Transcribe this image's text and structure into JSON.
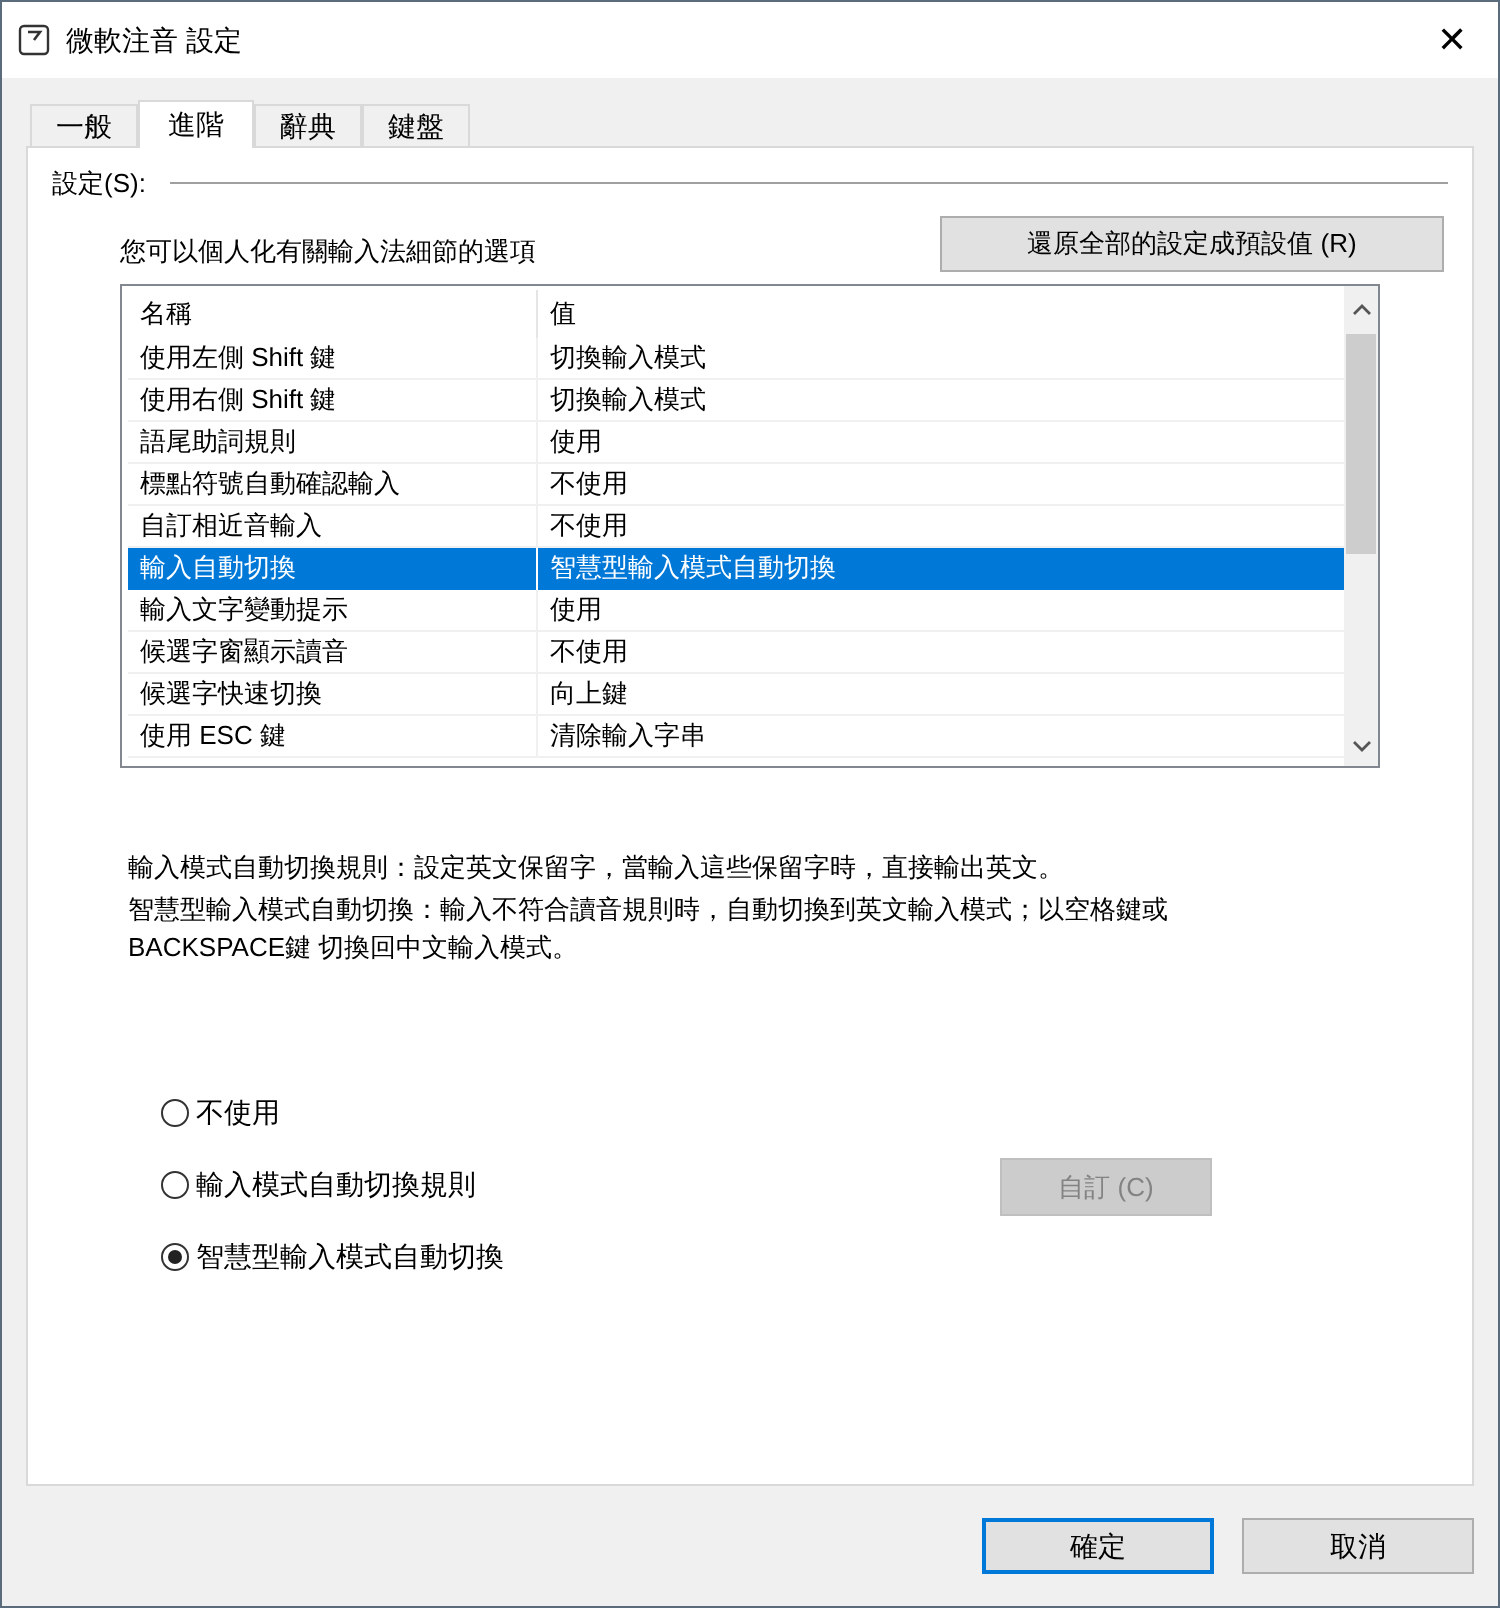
{
  "window": {
    "title": "微軟注音 設定",
    "close": "✕"
  },
  "tabs": [
    {
      "label": "一般",
      "selected": false
    },
    {
      "label": "進階",
      "selected": true
    },
    {
      "label": "辭典",
      "selected": false
    },
    {
      "label": "鍵盤",
      "selected": false
    }
  ],
  "group_label": "設定(S):",
  "intro": "您可以個人化有關輸入法細節的選項",
  "reset_button": "還原全部的設定成預設值 (R)",
  "table": {
    "columns": [
      "名稱",
      "值"
    ],
    "rows": [
      {
        "name": "使用左側 Shift 鍵",
        "value": "切換輸入模式",
        "selected": false
      },
      {
        "name": "使用右側 Shift 鍵",
        "value": "切換輸入模式",
        "selected": false
      },
      {
        "name": "語尾助詞規則",
        "value": "使用",
        "selected": false
      },
      {
        "name": "標點符號自動確認輸入",
        "value": "不使用",
        "selected": false
      },
      {
        "name": "自訂相近音輸入",
        "value": "不使用",
        "selected": false
      },
      {
        "name": "輸入自動切換",
        "value": "智慧型輸入模式自動切換",
        "selected": true
      },
      {
        "name": "輸入文字變動提示",
        "value": "使用",
        "selected": false
      },
      {
        "name": "候選字窗顯示讀音",
        "value": "不使用",
        "selected": false
      },
      {
        "name": "候選字快速切換",
        "value": "向上鍵",
        "selected": false
      },
      {
        "name": "使用 ESC 鍵",
        "value": "清除輸入字串",
        "selected": false
      }
    ]
  },
  "description": [
    "輸入模式自動切換規則：設定英文保留字，當輸入這些保留字時，直接輸出英文。",
    "智慧型輸入模式自動切換：輸入不符合讀音規則時，自動切換到英文輸入模式；以空格鍵或 BACKSPACE鍵 切換回中文輸入模式。"
  ],
  "options": [
    {
      "label": "不使用",
      "selected": false
    },
    {
      "label": "輸入模式自動切換規則",
      "selected": false
    },
    {
      "label": "智慧型輸入模式自動切換",
      "selected": true
    }
  ],
  "custom_button": {
    "label": "自訂 (C)",
    "disabled": true
  },
  "buttons": [
    {
      "label": "確定",
      "default": true
    },
    {
      "label": "取消",
      "default": false
    }
  ]
}
